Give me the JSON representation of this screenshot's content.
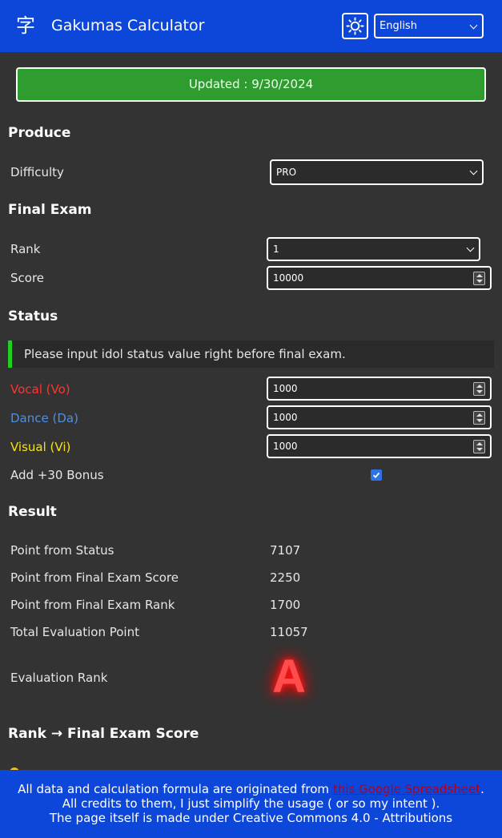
{
  "header": {
    "title": "Gakumas Calculator",
    "logo_glyph": "字",
    "theme_icon": "sun-icon",
    "language": "English"
  },
  "banner": {
    "text": "Updated : 9/30/2024"
  },
  "produce": {
    "title": "Produce",
    "difficulty_label": "Difficulty",
    "difficulty_value": "PRO"
  },
  "final_exam": {
    "title": "Final Exam",
    "rank_label": "Rank",
    "rank_value": "1",
    "score_label": "Score",
    "score_value": "10000"
  },
  "status": {
    "title": "Status",
    "note": "Please input idol status value right before final exam.",
    "vocal_label": "Vocal (Vo)",
    "vocal_value": "1000",
    "dance_label": "Dance (Da)",
    "dance_value": "1000",
    "visual_label": "Visual (Vi)",
    "visual_value": "1000",
    "bonus_label": "Add +30 Bonus",
    "bonus_checked": true,
    "colors": {
      "vocal": "#ff3333",
      "dance": "#4d8fe6",
      "visual": "#f5e31a"
    }
  },
  "result": {
    "title": "Result",
    "rows": [
      {
        "label": "Point from Status",
        "value": "7107"
      },
      {
        "label": "Point from Final Exam Score",
        "value": "2250"
      },
      {
        "label": "Point from Final Exam Rank",
        "value": "1700"
      },
      {
        "label": "Total Evaluation Point",
        "value": "11057"
      }
    ],
    "eval_rank_label": "Evaluation Rank",
    "eval_rank": "A"
  },
  "rank_score": {
    "title": "Rank → Final Exam Score"
  },
  "footer": {
    "line1_pre": "All data and calculation formula are originated from ",
    "link_text": "this Google Spreadsheet",
    "line1_post": ". All credits to them, I just simplify the usage ( or so my intent ).",
    "line2": "The page itself is made under Creative Commons 4.0 - Attributions"
  }
}
